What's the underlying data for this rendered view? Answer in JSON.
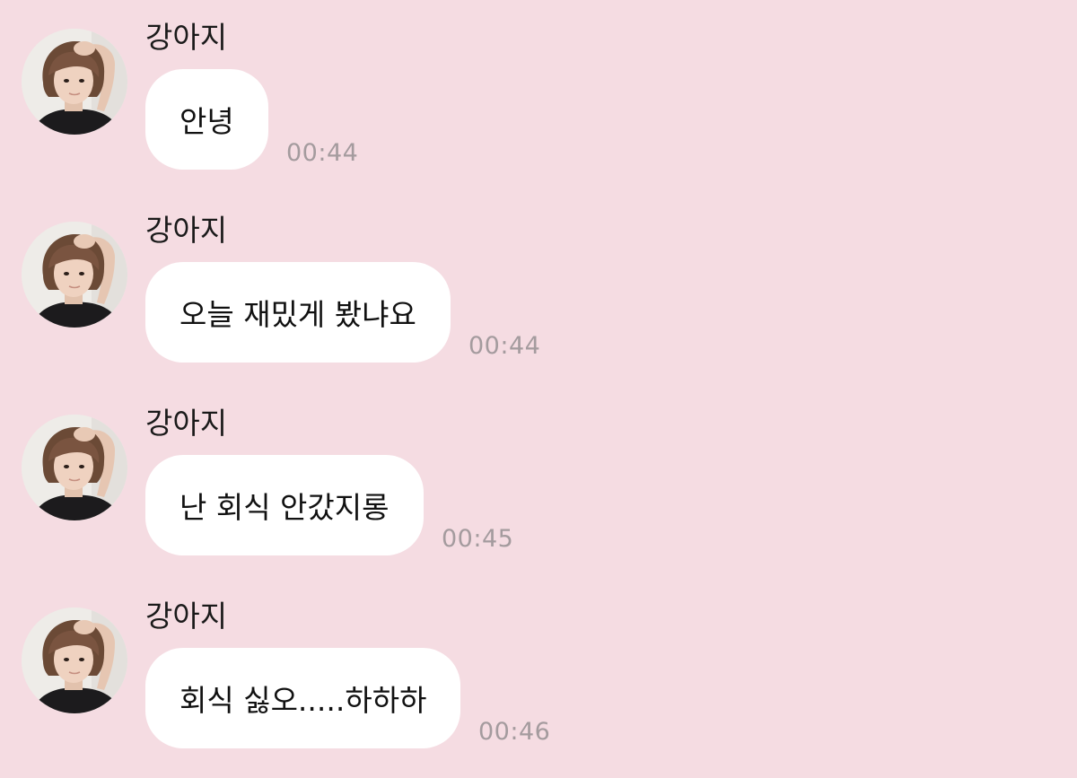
{
  "theme": {
    "background": "#f5dce2",
    "bubble": "#ffffff",
    "time_color": "#a49b9e"
  },
  "messages": [
    {
      "sender": "강아지",
      "avatar_icon": "profile-photo-icon",
      "text": "안녕",
      "time": "00:44"
    },
    {
      "sender": "강아지",
      "avatar_icon": "profile-photo-icon",
      "text": "오늘 재밌게 봤냐요",
      "time": "00:44"
    },
    {
      "sender": "강아지",
      "avatar_icon": "profile-photo-icon",
      "text": "난 회식 안갔지롱",
      "time": "00:45"
    },
    {
      "sender": "강아지",
      "avatar_icon": "profile-photo-icon",
      "text": "회식 싫오.....하하하",
      "time": "00:46"
    }
  ]
}
